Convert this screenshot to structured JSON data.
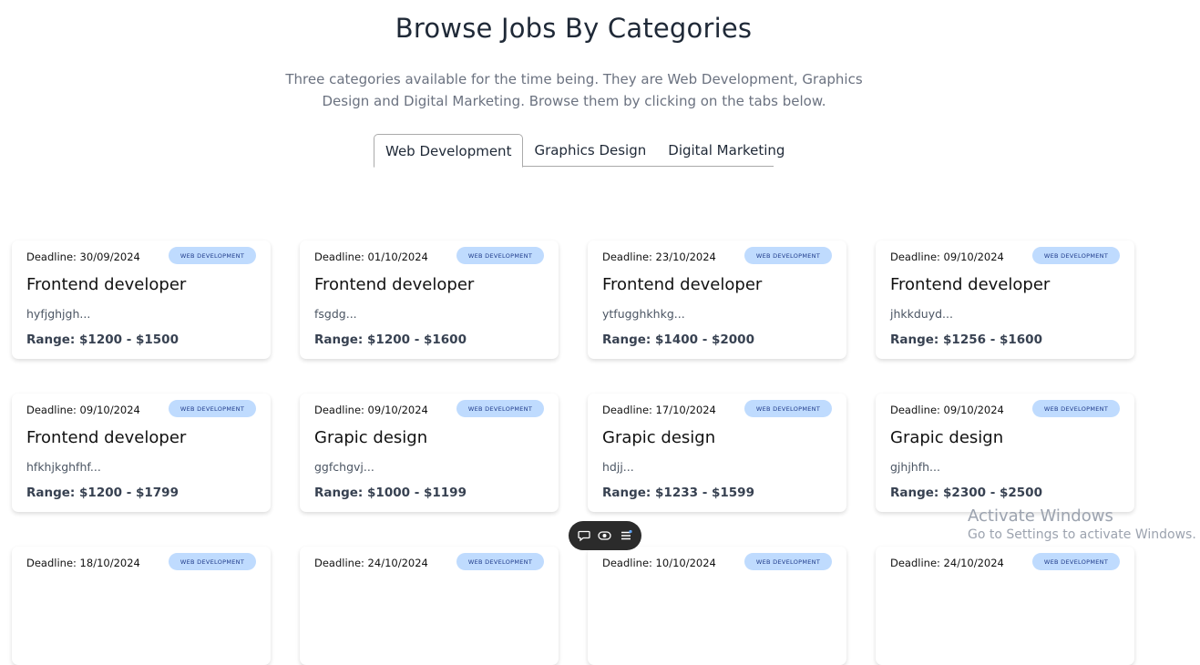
{
  "header": {
    "title": "Browse Jobs By Categories",
    "subtitle": "Three categories available for the time being. They are Web Development, Graphics Design and Digital Marketing. Browse them by clicking on the tabs below."
  },
  "tabs": [
    {
      "label": "Web Development",
      "active": true
    },
    {
      "label": "Graphics Design",
      "active": false
    },
    {
      "label": "Digital Marketing",
      "active": false
    }
  ],
  "badge_label": "WEB DEVELOPMENT",
  "colors": {
    "badge_bg": "#bfdbfe",
    "badge_text": "#1e3a8a",
    "toolbar_bg": "#2b2b2b"
  },
  "cards": [
    {
      "deadline": "Deadline: 30/09/2024",
      "title": "Frontend developer",
      "desc": "hyfjghjgh...",
      "range": "Range: $1200 - $1500"
    },
    {
      "deadline": "Deadline: 01/10/2024",
      "title": "Frontend developer",
      "desc": "fsgdg...",
      "range": "Range: $1200 - $1600"
    },
    {
      "deadline": "Deadline: 23/10/2024",
      "title": "Frontend developer",
      "desc": "ytfugghkhkg...",
      "range": "Range: $1400 - $2000"
    },
    {
      "deadline": "Deadline: 09/10/2024",
      "title": "Frontend developer",
      "desc": "jhkkduyd...",
      "range": "Range: $1256 - $1600"
    },
    {
      "deadline": "Deadline: 09/10/2024",
      "title": "Frontend developer",
      "desc": "hfkhjkghfhf...",
      "range": "Range: $1200 - $1799"
    },
    {
      "deadline": "Deadline: 09/10/2024",
      "title": "Grapic design",
      "desc": "ggfchgvj...",
      "range": "Range: $1000 - $1199"
    },
    {
      "deadline": "Deadline: 17/10/2024",
      "title": "Grapic design",
      "desc": "hdjj...",
      "range": "Range: $1233 - $1599"
    },
    {
      "deadline": "Deadline: 09/10/2024",
      "title": "Grapic design",
      "desc": "gjhjhfh...",
      "range": "Range: $2300 - $2500"
    },
    {
      "deadline": "Deadline: 18/10/2024",
      "title": "",
      "desc": "",
      "range": ""
    },
    {
      "deadline": "Deadline: 24/10/2024",
      "title": "",
      "desc": "",
      "range": ""
    },
    {
      "deadline": "Deadline: 10/10/2024",
      "title": "",
      "desc": "",
      "range": ""
    },
    {
      "deadline": "Deadline: 24/10/2024",
      "title": "",
      "desc": "",
      "range": ""
    }
  ],
  "toolbar": {
    "icons": [
      "chat-icon",
      "eye-toggle-icon",
      "menu-icon"
    ]
  },
  "watermark": {
    "line1": "Activate Windows",
    "line2": "Go to Settings to activate Windows."
  }
}
